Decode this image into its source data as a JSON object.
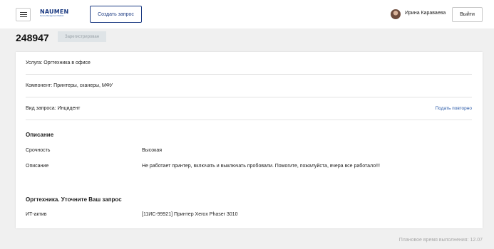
{
  "header": {
    "logo_text": "NAUMEN",
    "logo_sub": "Service Management Platform",
    "create_label": "Создать запрос",
    "user_name": "Ирина Караваева",
    "logout_label": "Выйти"
  },
  "request": {
    "number": "248947",
    "status": "Зарегистрирован"
  },
  "details": {
    "service": "Услуга: Оргтехника в офисе",
    "component": "Компонент: Принтеры, сканеры, МФУ",
    "request_type": "Вид запроса: Инцидент",
    "resubmit_label": "Подать повторно"
  },
  "description": {
    "title": "Описание",
    "urgency_label": "Срочность",
    "urgency_value": "Высокая",
    "desc_label": "Описание",
    "desc_value": "Не работает принтер, включать и выключать пробовали. Помогите, пожалуйста, вчера все работало!!!"
  },
  "clarify": {
    "title": "Оргтехника. Уточните Ваш запрос",
    "asset_label": "ИТ-актив",
    "asset_value": "[11ИС-99921] Принтер Xerox Phaser 3010"
  },
  "footer": {
    "planned_time": "Плановое время выполнения: 12.07"
  },
  "colors": {
    "brand": "#1b3a82",
    "link": "#2a5aa8",
    "background": "#f0f0f0"
  }
}
